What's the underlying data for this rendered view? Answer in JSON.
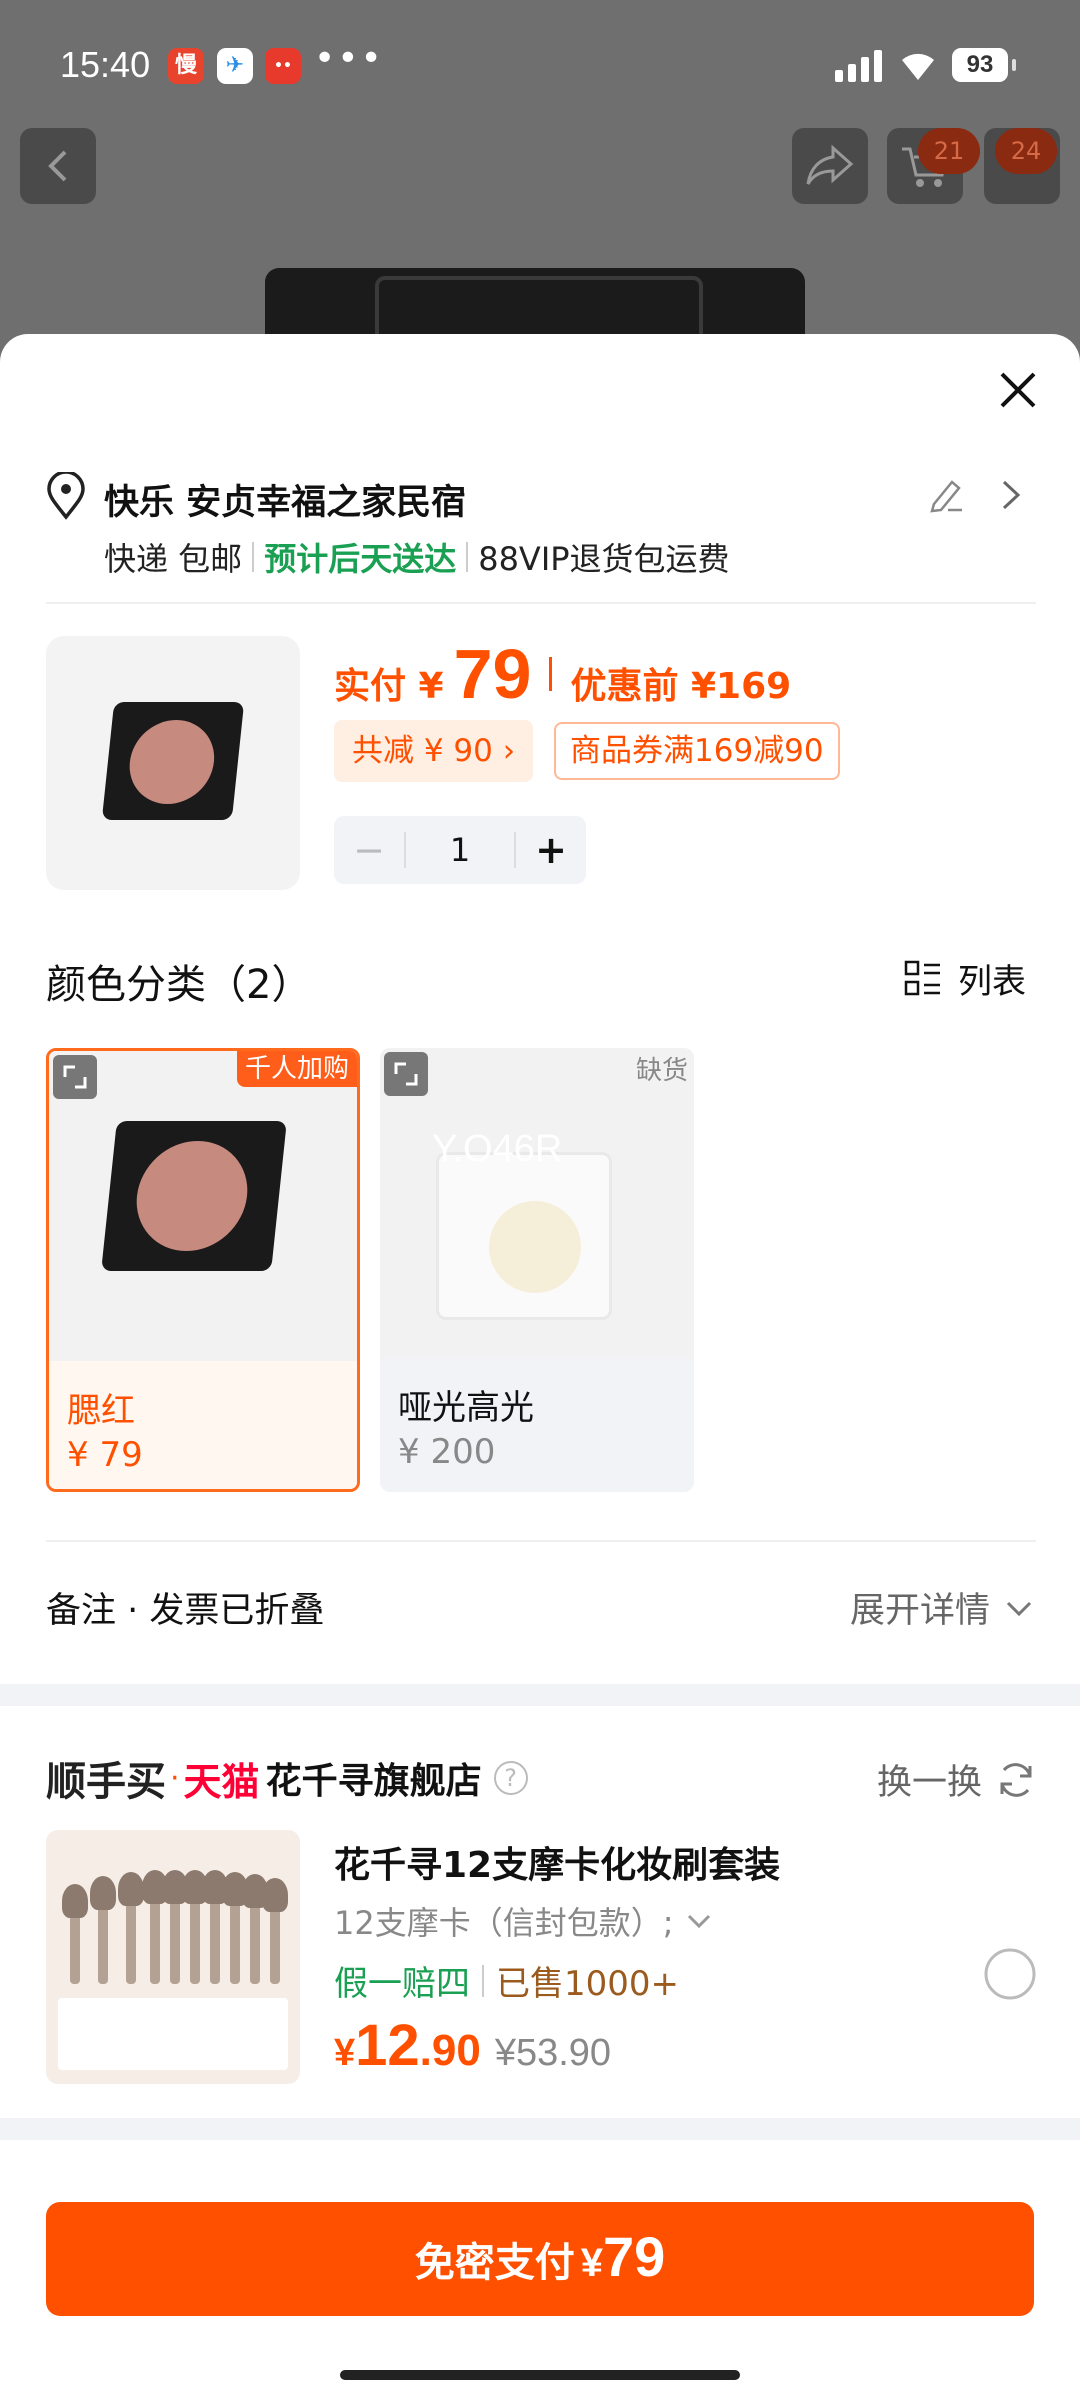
{
  "status_bar": {
    "time": "15:40",
    "battery": "93",
    "apps": [
      "慢",
      "✈",
      "••"
    ],
    "more": "•••"
  },
  "nav": {
    "cart_badge_1": "21",
    "cart_badge_2": "24"
  },
  "address": {
    "text": "快乐 安贞幸福之家民宿",
    "shipping": "快递 包邮",
    "eta": "预计后天送达",
    "return": "88VIP退货包运费"
  },
  "product": {
    "pay_label": "实付 ¥",
    "pay_price": "79",
    "before_label": "优惠前 ¥169",
    "discount_tag": "共减 ¥ 90 ›",
    "coupon_tag": "商品券满169减90",
    "quantity": "1",
    "minus": "−",
    "plus": "+"
  },
  "variants": {
    "title": "颜色分类（2）",
    "list_toggle": "列表",
    "items": [
      {
        "name": "腮红",
        "price": "¥ 79",
        "badge": "千人加购",
        "selected": true
      },
      {
        "name": "哑光高光",
        "price": "¥ 200",
        "badge": "缺货",
        "watermark": "Y.O46R",
        "selected": false
      }
    ]
  },
  "notes": {
    "label": "备注 · 发票已折叠",
    "expand": "展开详情"
  },
  "recommend": {
    "brand_main": "顺手买",
    "dot": "·",
    "brand_tmall": "天猫",
    "store": "花千寻旗舰店",
    "help": "?",
    "swap": "换一换",
    "title": "花千寻12支摩卡化妆刷套装",
    "sku": "12支摩卡（信封包款）;",
    "guarantee": "假一赔四",
    "sold": "已售1000+",
    "price_currency": "¥",
    "price_int": "12",
    "price_dec": ".90",
    "orig_price": "¥53.90"
  },
  "pay_button": {
    "label": "免密支付",
    "currency": "¥",
    "amount": "79"
  },
  "colors": {
    "accent": "#ff5000",
    "green": "#1aa053",
    "tmall_red": "#ff0036"
  }
}
